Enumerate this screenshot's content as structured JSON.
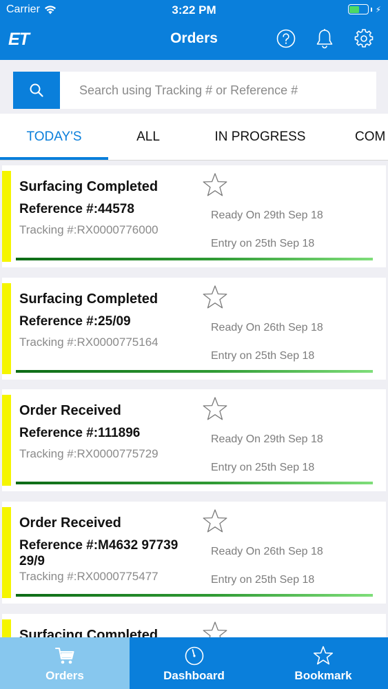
{
  "status_bar": {
    "carrier": "Carrier",
    "time": "3:22 PM"
  },
  "nav": {
    "logo": "ET",
    "title": "Orders",
    "icons": [
      "help-icon",
      "bell-icon",
      "gear-icon"
    ]
  },
  "search": {
    "placeholder": "Search using Tracking # or Reference #",
    "value": ""
  },
  "tabs": [
    {
      "label": "TODAY'S",
      "active": true
    },
    {
      "label": "ALL",
      "active": false
    },
    {
      "label": "IN PROGRESS",
      "active": false
    },
    {
      "label": "COM",
      "active": false
    }
  ],
  "orders": [
    {
      "status": "Surfacing Completed",
      "reference": "Reference #:44578",
      "tracking": "Tracking #:RX0000776000",
      "ready": "Ready On 29th Sep 18",
      "entry": "Entry on 25th Sep 18",
      "progress": 1.0
    },
    {
      "status": "Surfacing Completed",
      "reference": "Reference #:25/09",
      "tracking": "Tracking #:RX0000775164",
      "ready": "Ready On 26th Sep 18",
      "entry": "Entry on 25th Sep 18",
      "progress": 1.0
    },
    {
      "status": "Order Received",
      "reference": "Reference #:111896",
      "tracking": "Tracking #:RX0000775729",
      "ready": "Ready On 29th Sep 18",
      "entry": "Entry on 25th Sep 18",
      "progress": 1.0
    },
    {
      "status": "Order Received",
      "reference": "Reference #:M4632 97739 29/9",
      "tracking": "Tracking #:RX0000775477",
      "ready": "Ready On 26th Sep 18",
      "entry": "Entry on 25th Sep 18",
      "progress": 1.0
    },
    {
      "status": "Surfacing Completed",
      "reference": "",
      "tracking": "",
      "ready": "",
      "entry": "",
      "progress": 1.0
    }
  ],
  "bottom_tabs": [
    {
      "label": "Orders",
      "icon": "cart-icon",
      "active": true
    },
    {
      "label": "Dashboard",
      "icon": "gauge-icon",
      "active": false
    },
    {
      "label": "Bookmark",
      "icon": "star-icon",
      "active": false
    }
  ],
  "colors": {
    "primary": "#0a7fdb",
    "active_bottom_tab": "#87c7ee",
    "status_stripe": "#f5f500",
    "progress": "#2f9a34"
  }
}
